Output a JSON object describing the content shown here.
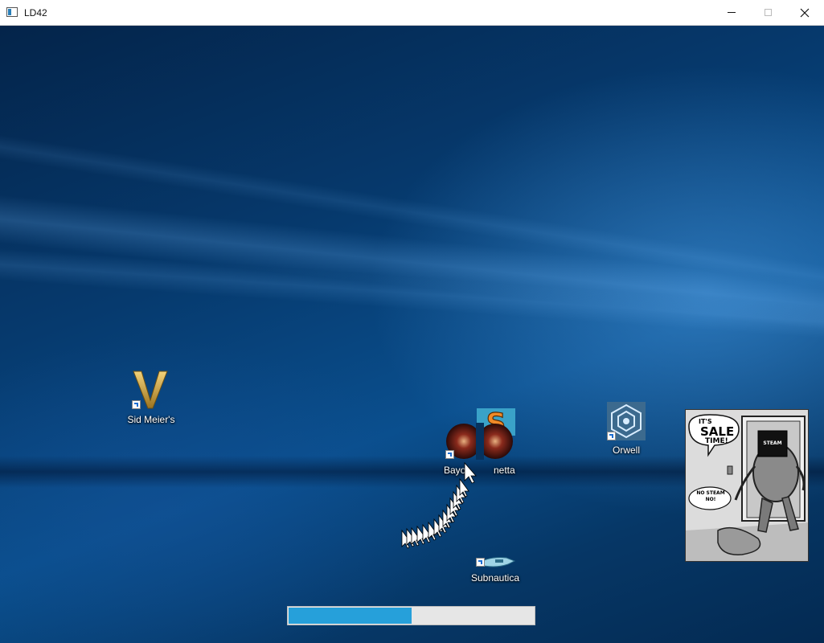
{
  "window": {
    "title": "LD42",
    "app_icon": "window-app-icon",
    "controls": {
      "minimize": "minimize-icon",
      "maximize": "maximize-icon",
      "close": "close-icon"
    }
  },
  "desktop_icons": [
    {
      "label": "Sid Meier's",
      "icon": "civilization-v-icon"
    },
    {
      "label": "Bayo",
      "icon": "bayonetta-icon"
    },
    {
      "label": "netta",
      "icon": "bayonetta-icon"
    },
    {
      "label": "Orwell",
      "icon": "orwell-icon"
    },
    {
      "label": "Subnautica",
      "icon": "subnautica-icon"
    }
  ],
  "comic": {
    "speech": [
      "IT'S",
      "SALE",
      "TIME!"
    ],
    "badge": "STEAM",
    "reply": [
      "NO STEAM",
      "NO!"
    ]
  },
  "progress": {
    "value": 0.5
  },
  "colors": {
    "progress_fill": "#26a0da",
    "progress_track": "#e6e6e6",
    "civ_gold": "#d4a83a",
    "orwell_blue": "#4a7ea6"
  }
}
